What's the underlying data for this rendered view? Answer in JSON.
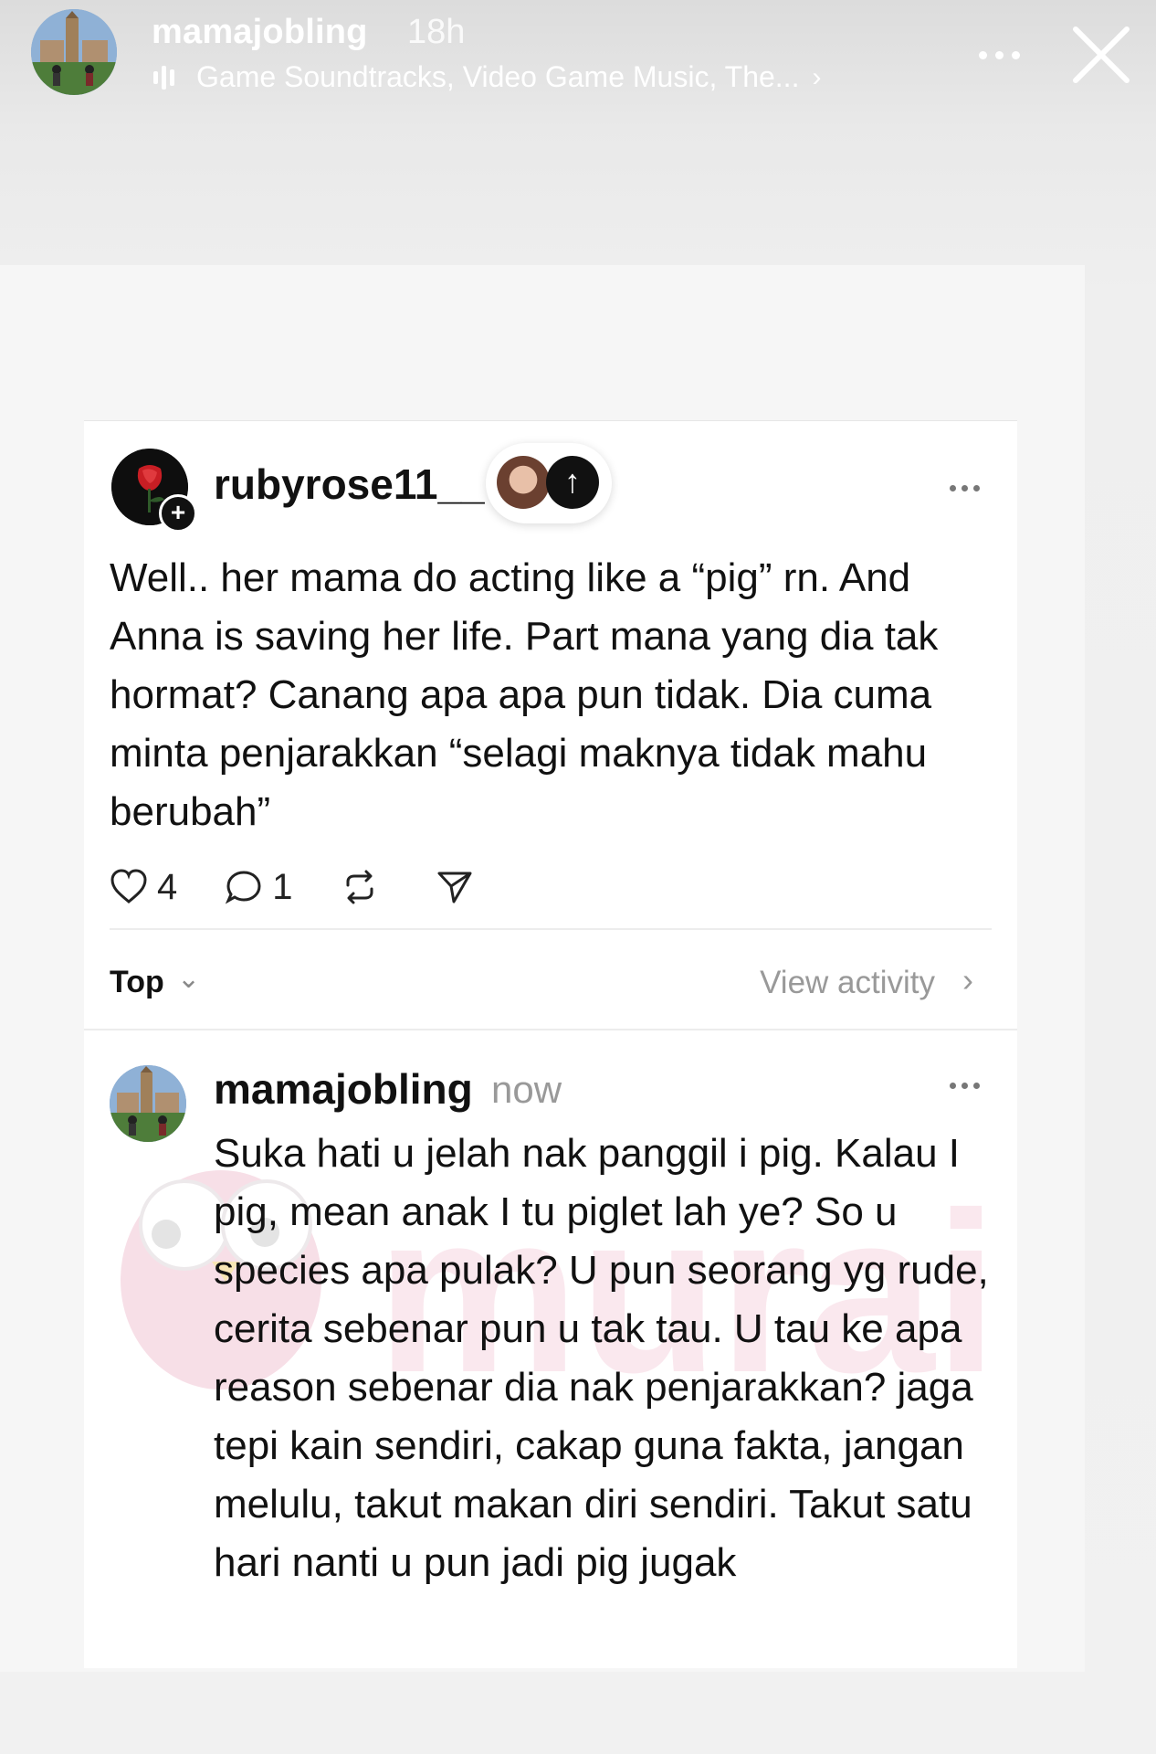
{
  "story": {
    "username": "mamajobling",
    "time": "18h",
    "music": "Game Soundtracks, Video Game Music, The...",
    "music_chevron": "›"
  },
  "post": {
    "username": "rubyrose11__",
    "text": "Well.. her mama do acting like a “pig” rn. And Anna is saving her life. Part mana yang dia tak hormat? Canang apa apa pun tidak. Dia cuma minta penjarakkan “selagi maknya tidak mahu berubah”",
    "likes": "4",
    "comments": "1",
    "arrow_glyph": "↑",
    "plus_glyph": "+"
  },
  "sort": {
    "label": "Top",
    "chevron": "⌄",
    "view_activity": "View activity",
    "view_chevron": "›"
  },
  "reply": {
    "username": "mamajobling",
    "time": "now",
    "text": "Suka hati u jelah nak panggil i pig. Kalau I pig, mean anak I tu piglet lah ye? So u species apa pulak? U pun seorang yg rude, cerita sebenar pun u tak tau. U tau ke apa reason sebenar dia nak penjarakkan? jaga tepi kain sendiri, cakap guna fakta, jangan melulu, takut makan diri sendiri. Takut satu hari nanti u pun jadi pig jugak"
  },
  "watermark_text": "murai",
  "icons": {
    "close": "close-icon",
    "more": "more-icon",
    "heart": "heart-icon",
    "comment": "comment-icon",
    "repost": "repost-icon",
    "share": "send-icon",
    "music": "music-bars-icon"
  },
  "colors": {
    "background": "#f1f1f1",
    "card": "#ffffff",
    "text": "#111111",
    "muted": "#999999",
    "watermark": "#f3c8d6"
  }
}
